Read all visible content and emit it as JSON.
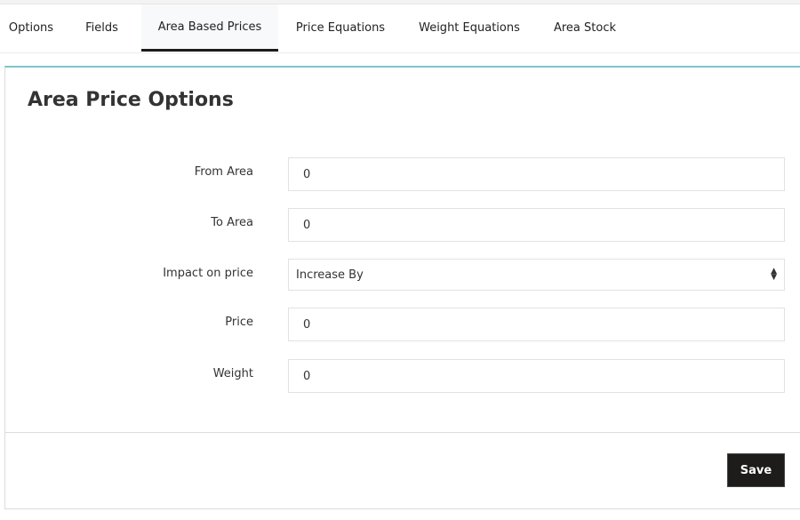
{
  "tabs": [
    {
      "label": "Options",
      "active": false
    },
    {
      "label": "Fields",
      "active": false
    },
    {
      "label": "Area Based Prices",
      "active": true
    },
    {
      "label": "Price Equations",
      "active": false
    },
    {
      "label": "Weight Equations",
      "active": false
    },
    {
      "label": "Area Stock",
      "active": false
    }
  ],
  "panel": {
    "title": "Area Price Options",
    "fields": {
      "from_area": {
        "label": "From Area",
        "value": "0"
      },
      "to_area": {
        "label": "To Area",
        "value": "0"
      },
      "impact_on_price": {
        "label": "Impact on price",
        "selected": "Increase By",
        "icon": "sort-arrows-icon"
      },
      "price": {
        "label": "Price",
        "value": "0"
      },
      "weight": {
        "label": "Weight",
        "value": "0"
      }
    },
    "save_label": "Save"
  },
  "colors": {
    "accent_border": "#7fc4cc",
    "active_tab_underline": "#1b1b1b",
    "save_button_bg": "#1e1c1a"
  }
}
